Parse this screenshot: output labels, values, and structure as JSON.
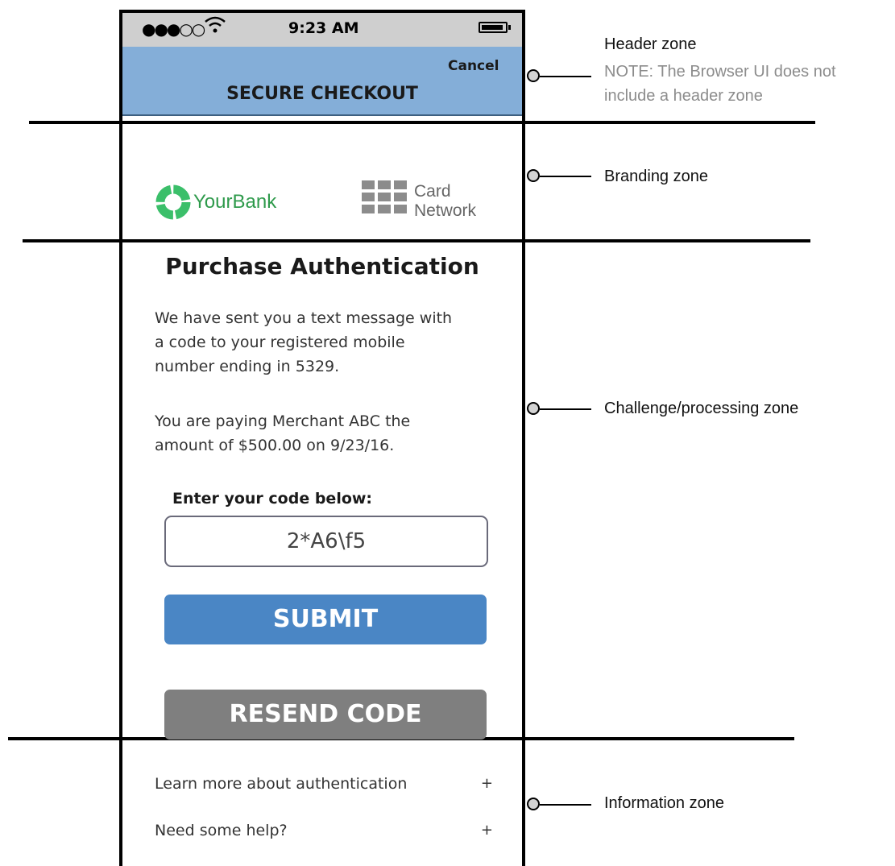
{
  "status_bar": {
    "signal_dots": "●●●○○",
    "time": "9:23 AM"
  },
  "header": {
    "cancel_label": "Cancel",
    "title": "SECURE CHECKOUT"
  },
  "branding": {
    "bank_name": "YourBank",
    "card_network_line1": "Card",
    "card_network_line2": "Network",
    "bank_color": "#2e9a4b"
  },
  "challenge": {
    "title": "Purchase Authentication",
    "message_lines": [
      "We have sent you a text message with",
      "a code to your registered mobile",
      "number ending in 5329."
    ],
    "payment_lines": [
      "You are paying Merchant ABC the",
      "amount of $500.00 on 9/23/16."
    ],
    "code_label": "Enter your code below:",
    "code_value": "2*A6\\f5",
    "submit_label": "SUBMIT",
    "resend_label": "RESEND CODE",
    "submit_color": "#4a86c5",
    "resend_color": "#7f7f7f"
  },
  "information": {
    "items": [
      {
        "label": "Learn more about authentication",
        "icon": "+"
      },
      {
        "label": "Need some help?",
        "icon": "+"
      }
    ]
  },
  "annotations": {
    "header_zone": "Header zone",
    "header_note_line1": "NOTE: The Browser UI does not",
    "header_note_line2": "include a header zone",
    "branding_zone": "Branding zone",
    "challenge_zone": "Challenge/processing zone",
    "information_zone": "Information zone"
  }
}
